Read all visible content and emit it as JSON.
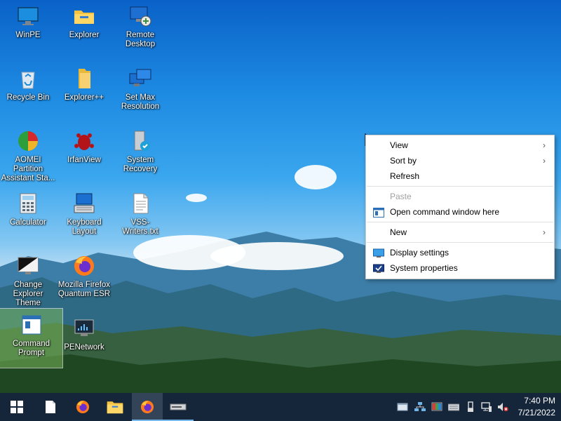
{
  "desktop": {
    "icons": [
      {
        "label": "WinPE",
        "icon": "monitor-icon"
      },
      {
        "label": "Explorer",
        "icon": "folder-icon"
      },
      {
        "label": "Remote Desktop",
        "icon": "remote-desktop-icon"
      },
      {
        "label": "Recycle Bin",
        "icon": "recycle-bin-icon"
      },
      {
        "label": "Explorer++",
        "icon": "folder-plus-icon"
      },
      {
        "label": "Set Max Resolution",
        "icon": "display-resolution-icon"
      },
      {
        "label": "AOMEI Partition Assistant Sta...",
        "icon": "partition-icon"
      },
      {
        "label": "IrfanView",
        "icon": "irfanview-icon"
      },
      {
        "label": "System Recovery",
        "icon": "system-recovery-icon"
      },
      {
        "label": "Calculator",
        "icon": "calculator-icon"
      },
      {
        "label": "Keyboard Layout",
        "icon": "keyboard-icon"
      },
      {
        "label": "VSS-Writers.txt",
        "icon": "text-file-icon"
      },
      {
        "label": "Change Explorer Theme",
        "icon": "theme-icon"
      },
      {
        "label": "Mozilla Firefox Quantum ESR",
        "icon": "firefox-icon"
      },
      {
        "label": "Command Prompt",
        "icon": "command-prompt-icon"
      },
      {
        "label": "PENetwork",
        "icon": "network-icon"
      }
    ]
  },
  "context_menu": {
    "view": "View",
    "sort_by": "Sort by",
    "refresh": "Refresh",
    "paste": "Paste",
    "open_cmd": "Open command window here",
    "new": "New",
    "display_settings": "Display settings",
    "system_properties": "System properties",
    "submenu_arrow": "›"
  },
  "taskbar": {
    "time": "7:40 PM",
    "date": "7/21/2022"
  },
  "colors": {
    "taskbar": "#15263a",
    "accent": "#76b9ed",
    "menu_bg": "#ffffff"
  }
}
